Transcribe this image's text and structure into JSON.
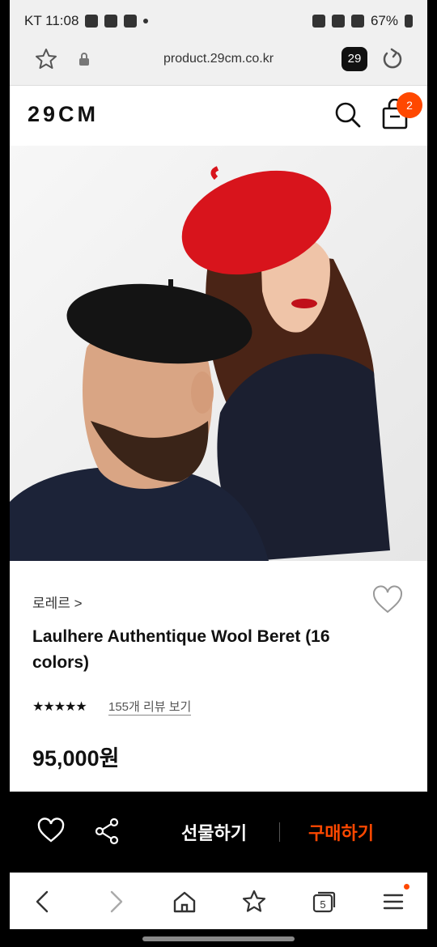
{
  "status_bar": {
    "carrier_time": "KT 11:08",
    "battery": "67%"
  },
  "browser": {
    "url": "product.29cm.co.kr",
    "tab_count": "29"
  },
  "site": {
    "logo": "29CM",
    "cart_count": "2"
  },
  "product": {
    "brand": "로레르 >",
    "name": "Laulhere Authentique Wool Beret (16 colors)",
    "rating_stars": "★★★★★",
    "review_link": "155개 리뷰 보기",
    "price": "95,000원"
  },
  "actions": {
    "gift_label": "선물하기",
    "buy_label": "구매하기"
  },
  "bottom_nav": {
    "tabs_count": "5"
  },
  "colors": {
    "accent": "#ff4800",
    "beret_red": "#d8141c",
    "navy": "#1c2338"
  }
}
